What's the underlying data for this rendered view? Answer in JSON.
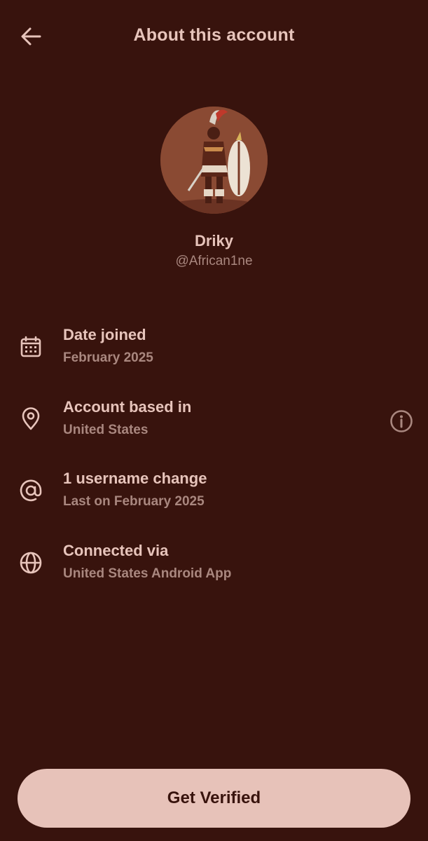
{
  "header": {
    "title": "About this account",
    "back_icon": "arrow-left-icon"
  },
  "profile": {
    "name": "Driky",
    "handle": "@African1ne"
  },
  "info_items": [
    {
      "icon": "calendar-icon",
      "title": "Date joined",
      "subtitle": "February 2025"
    },
    {
      "icon": "location-pin-icon",
      "title": "Account based in",
      "subtitle": "United States",
      "trailing_icon": "info-icon"
    },
    {
      "icon": "at-sign-icon",
      "title": "1 username change",
      "subtitle": "Last on February 2025"
    },
    {
      "icon": "globe-icon",
      "title": "Connected via",
      "subtitle": "United States Android App"
    }
  ],
  "cta": {
    "label": "Get Verified"
  },
  "colors": {
    "background": "#38130d",
    "text_primary": "#e7c4bb",
    "text_secondary": "#a9877f",
    "button_bg": "#e7c2b9",
    "button_text": "#38130d"
  }
}
